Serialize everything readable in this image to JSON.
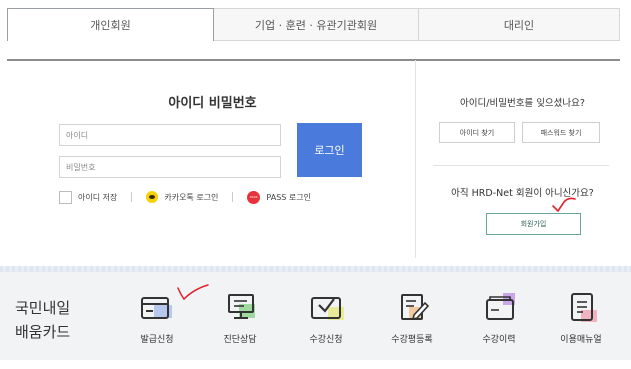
{
  "tabs": [
    {
      "label": "개인회원",
      "active": true
    },
    {
      "label": "기업 · 훈련 · 유관기관회원",
      "active": false
    },
    {
      "label": "대리인",
      "active": false
    }
  ],
  "login": {
    "title": "아이디 비밀번호",
    "id_placeholder": "아이디",
    "pw_placeholder": "비밀번호",
    "login_button": "로그인",
    "save_id": "아이디 저장",
    "kakao_login": "카카오톡 로그인",
    "pass_login": "PASS 로그인",
    "pass_icon_text": "PASS"
  },
  "find": {
    "question": "아이디/비밀번호를 잊으셨나요?",
    "find_id": "아이디 찾기",
    "find_pw": "패스워드 찾기"
  },
  "join": {
    "question": "아직 HRD-Net 회원이 아니신가요?",
    "button": "회원가입"
  },
  "card": {
    "title_line1": "국민내일",
    "title_line2": "배움카드",
    "menu": [
      {
        "label": "발급신청",
        "icon": "card-icon"
      },
      {
        "label": "진단상담",
        "icon": "monitor-icon"
      },
      {
        "label": "수강신청",
        "icon": "check-box-icon"
      },
      {
        "label": "수강평등록",
        "icon": "edit-icon"
      },
      {
        "label": "수강이력",
        "icon": "folder-icon"
      },
      {
        "label": "이용매뉴얼",
        "icon": "notebook-icon"
      }
    ]
  },
  "colors": {
    "login_button": "#4a7bdc",
    "join_border": "#6aa59a",
    "annotation": "#e0202a",
    "card_bar": "#f2f3f5"
  }
}
